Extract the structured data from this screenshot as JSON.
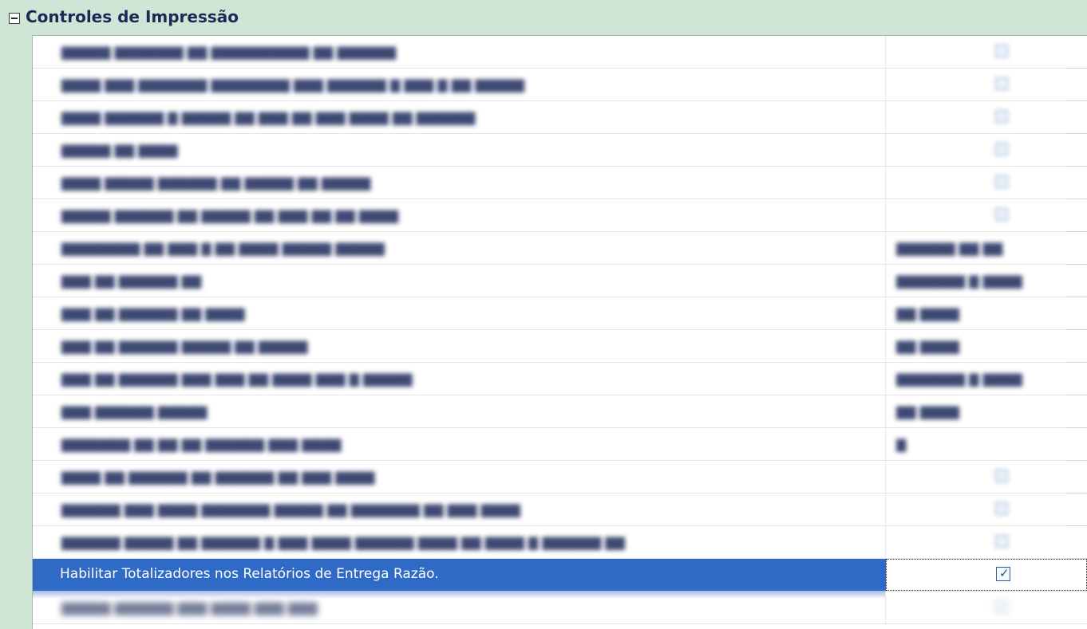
{
  "group": {
    "title": "Controles de Impressão",
    "expanded": true
  },
  "selected_row": {
    "label": "Habilitar Totalizadores nos Relatórios de Entrega Razão.",
    "checked": true
  },
  "colors": {
    "header_bg": "#cfe6d6",
    "title_text": "#1a2a57",
    "selection_bg": "#2e6ac6",
    "selection_text": "#ffffff"
  },
  "icons": {
    "toggle": "collapse-minus-icon",
    "checkbox": "checkbox-checked-icon"
  }
}
